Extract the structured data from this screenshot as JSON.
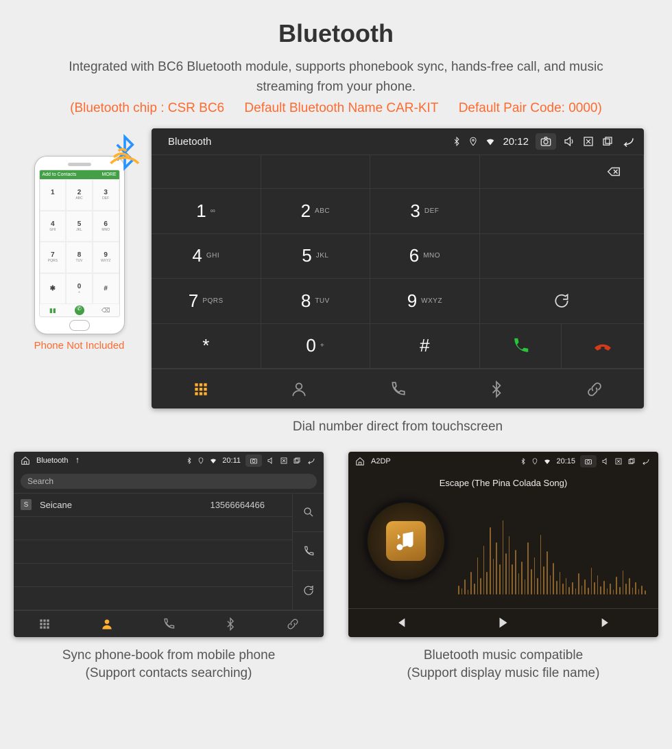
{
  "page": {
    "title": "Bluetooth",
    "subtitle": "Integrated with BC6 Bluetooth module, supports phonebook sync, hands-free call, and music streaming from your phone.",
    "specs": {
      "chip": "(Bluetooth chip : CSR BC6",
      "name": "Default Bluetooth Name CAR-KIT",
      "code": "Default Pair Code: 0000)"
    },
    "phone_caption": "Phone Not Included",
    "phone_ui": {
      "add_label": "Add to Contacts",
      "more_label": "MORE"
    }
  },
  "dialer": {
    "status": {
      "title": "Bluetooth",
      "time": "20:12"
    },
    "keys": [
      {
        "d": "1",
        "s": "∞"
      },
      {
        "d": "2",
        "s": "ABC"
      },
      {
        "d": "3",
        "s": "DEF"
      },
      {
        "d": "4",
        "s": "GHI"
      },
      {
        "d": "5",
        "s": "JKL"
      },
      {
        "d": "6",
        "s": "MNO"
      },
      {
        "d": "7",
        "s": "PQRS"
      },
      {
        "d": "8",
        "s": "TUV"
      },
      {
        "d": "9",
        "s": "WXYZ"
      },
      {
        "d": "*",
        "s": ""
      },
      {
        "d": "0",
        "s": "+"
      },
      {
        "d": "#",
        "s": ""
      }
    ],
    "caption": "Dial number direct from touchscreen"
  },
  "phonebook": {
    "status": {
      "title": "Bluetooth",
      "time": "20:11"
    },
    "search_placeholder": "Search",
    "rows": [
      {
        "tag": "S",
        "name": "Seicane",
        "number": "13566664466"
      }
    ],
    "caption1": "Sync phone-book from mobile phone",
    "caption2": "(Support contacts searching)"
  },
  "music": {
    "status": {
      "title": "A2DP",
      "time": "20:15"
    },
    "track": "Escape (The Pina Colada Song)",
    "caption1": "Bluetooth music compatible",
    "caption2": "(Support display music file name)"
  },
  "icons": {
    "home": "home",
    "usb": "usb",
    "bt": "bluetooth",
    "loc": "location",
    "wifi": "wifi",
    "cam": "camera",
    "vol": "volume",
    "mute": "close-box",
    "recents": "overlap",
    "back": "back-arrow"
  }
}
